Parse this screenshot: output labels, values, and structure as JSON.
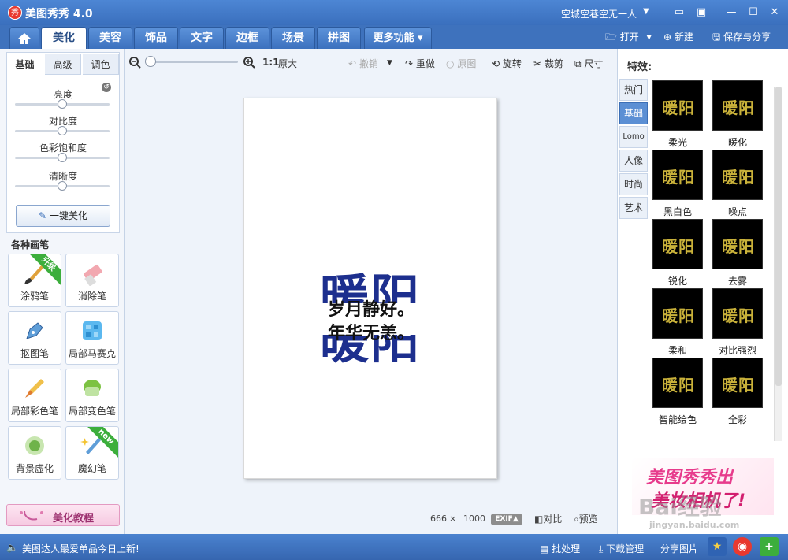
{
  "app": {
    "title": "美图秀秀 4.0",
    "logo_text": "秀"
  },
  "user": {
    "name": "空城空巷空无一人"
  },
  "tabs": [
    "美化",
    "美容",
    "饰品",
    "文字",
    "边框",
    "场景",
    "拼图",
    "更多功能"
  ],
  "top_actions": {
    "open": "打开",
    "new": "新建",
    "save": "保存与分享"
  },
  "left": {
    "subtabs": [
      "基础",
      "高级",
      "调色"
    ],
    "sliders": [
      {
        "label": "亮度",
        "value": 0.5
      },
      {
        "label": "对比度",
        "value": 0.5
      },
      {
        "label": "色彩饱和度",
        "value": 0.5
      },
      {
        "label": "清晰度",
        "value": 0.5
      }
    ],
    "one_click": "一键美化",
    "brush_section": "各种画笔",
    "brushes": [
      {
        "label": "涂鸦笔",
        "badge": "升级"
      },
      {
        "label": "消除笔",
        "badge": ""
      },
      {
        "label": "抠图笔",
        "badge": ""
      },
      {
        "label": "局部马赛克",
        "badge": ""
      },
      {
        "label": "局部彩色笔",
        "badge": ""
      },
      {
        "label": "局部变色笔",
        "badge": ""
      },
      {
        "label": "背景虚化",
        "badge": ""
      },
      {
        "label": "魔幻笔",
        "badge": "new"
      }
    ],
    "tutorial": "美化教程"
  },
  "toolbar": {
    "ratio": "1:1",
    "original_size": "原大",
    "undo": "撤销",
    "redo": "重做",
    "original": "原图",
    "rotate": "旋转",
    "crop": "裁剪",
    "size": "尺寸",
    "zoom_value": 0.02
  },
  "canvas": {
    "big_top": "暖阳",
    "big_bottom": "暖阳",
    "line1": "岁月静好。",
    "line2": "年华无恙。",
    "width": "666",
    "times": "×",
    "height": "1000",
    "exif": "EXIF▲",
    "compare": "对比",
    "preview": "预览"
  },
  "right": {
    "title": "特效:",
    "categories": [
      "热门",
      "基础",
      "Lomo",
      "人像",
      "时尚",
      "艺术"
    ],
    "active_category": 1,
    "effects": [
      "柔光",
      "暖化",
      "黑白色",
      "噪点",
      "锐化",
      "去雾",
      "柔和",
      "对比强烈",
      "智能绘色",
      "全彩"
    ],
    "ad_line1": "美图秀秀出",
    "ad_line2": "美妆相机了!"
  },
  "bottom": {
    "news": "美图达人最爱单品今日上新!",
    "batch": "批处理",
    "download": "下载管理",
    "share": "分享图片"
  },
  "colors": {
    "accent": "#3e72bd",
    "active_tab_text": "#2a4f86",
    "ad_pink": "#e73b8c"
  }
}
